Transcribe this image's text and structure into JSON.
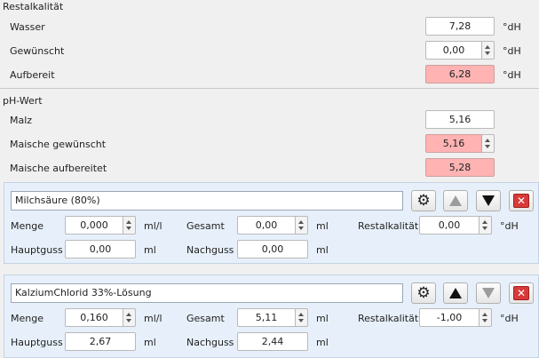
{
  "restalkalitaet": {
    "title": "Restalkalität",
    "rows": [
      {
        "label": "Wasser",
        "value": "7,28",
        "unit": "°dH"
      },
      {
        "label": "Gewünscht",
        "value": "0,00",
        "unit": "°dH"
      },
      {
        "label": "Aufbereit",
        "value": "6,28",
        "unit": "°dH"
      }
    ]
  },
  "ph": {
    "title": "pH-Wert",
    "rows": [
      {
        "label": "Malz",
        "value": "5,16"
      },
      {
        "label": "Maische gewünscht",
        "value": "5,16"
      },
      {
        "label": "Maische aufbereitet",
        "value": "5,28"
      }
    ]
  },
  "additives": [
    {
      "name": "Milchsäure (80%)",
      "menge_label": "Menge",
      "menge_value": "0,000",
      "menge_unit": "ml/l",
      "gesamt_label": "Gesamt",
      "gesamt_value": "0,00",
      "gesamt_unit": "ml",
      "rest_label": "Restalkalität",
      "rest_value": "0,00",
      "rest_unit": "°dH",
      "hauptguss_label": "Hauptguss",
      "hauptguss_value": "0,00",
      "hauptguss_unit": "ml",
      "nachguss_label": "Nachguss",
      "nachguss_value": "0,00",
      "nachguss_unit": "ml"
    },
    {
      "name": "KalziumChlorid 33%-Lösung",
      "menge_label": "Menge",
      "menge_value": "0,160",
      "menge_unit": "ml/l",
      "gesamt_label": "Gesamt",
      "gesamt_value": "5,11",
      "gesamt_unit": "ml",
      "rest_label": "Restalkalität",
      "rest_value": "-1,00",
      "rest_unit": "°dH",
      "hauptguss_label": "Hauptguss",
      "hauptguss_value": "2,67",
      "hauptguss_unit": "ml",
      "nachguss_label": "Nachguss",
      "nachguss_value": "2,44",
      "nachguss_unit": "ml"
    }
  ],
  "icons": {
    "settings": "gear-icon",
    "move_up": "arrow-up-icon",
    "move_down": "arrow-down-icon",
    "remove": "close-icon",
    "gear_glyph": "⚙",
    "close_glyph": "✕"
  },
  "colors": {
    "highlight": "#ffb3b3",
    "panel_bg": "#e7f0fa"
  }
}
